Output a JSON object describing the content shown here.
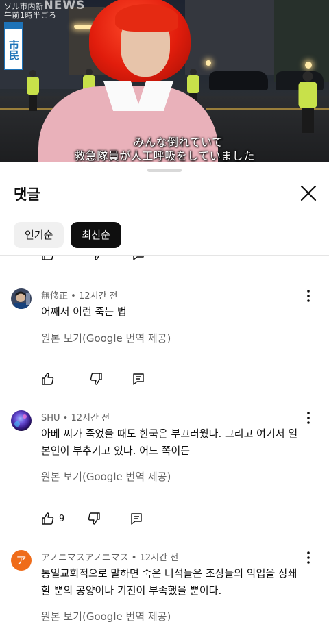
{
  "video": {
    "watermark_top": "ソル市内新",
    "watermark_news": "NEWS",
    "watermark_time": "午前1時半ごろ",
    "badge": "市民",
    "subtitle_line1": "みんな倒れていて",
    "subtitle_line2": "救急隊員が人工呼吸をしていました"
  },
  "sheet": {
    "title": "댓글",
    "chips": [
      "인기순",
      "최신순"
    ],
    "active_chip": 1
  },
  "comments": [
    {
      "author": "無修正",
      "time": "12시간 전",
      "text": "어째서 이런 죽는 법",
      "translate": "원본 보기(Google 번역 제공)",
      "likes": ""
    },
    {
      "author": "SHU",
      "time": "12시간 전",
      "text": "아베 씨가 죽었을 때도 한국은 부끄러웠다. 그리고 여기서 일본인이 부추기고 있다. 어느 쪽이든",
      "translate": "원본 보기(Google 번역 제공)",
      "likes": "9"
    },
    {
      "author": "アノニマスアノニマス",
      "time": "12시간 전",
      "text": "통일교회적으로 말하면 죽은 녀석들은 조상들의 악업을 상쇄할 뿐의 공양이나 기진이 부족했을 뿐이다.",
      "translate": "원본 보기(Google 번역 제공)",
      "avatar_letter": "ア"
    }
  ],
  "separator": " • ",
  "colors": {
    "text_primary": "#0f0f0f",
    "text_secondary": "#606060",
    "chip_active_bg": "#0f0f0f",
    "chip_bg": "#f0f0f0",
    "avatar_orange": "#ef6c1a"
  }
}
